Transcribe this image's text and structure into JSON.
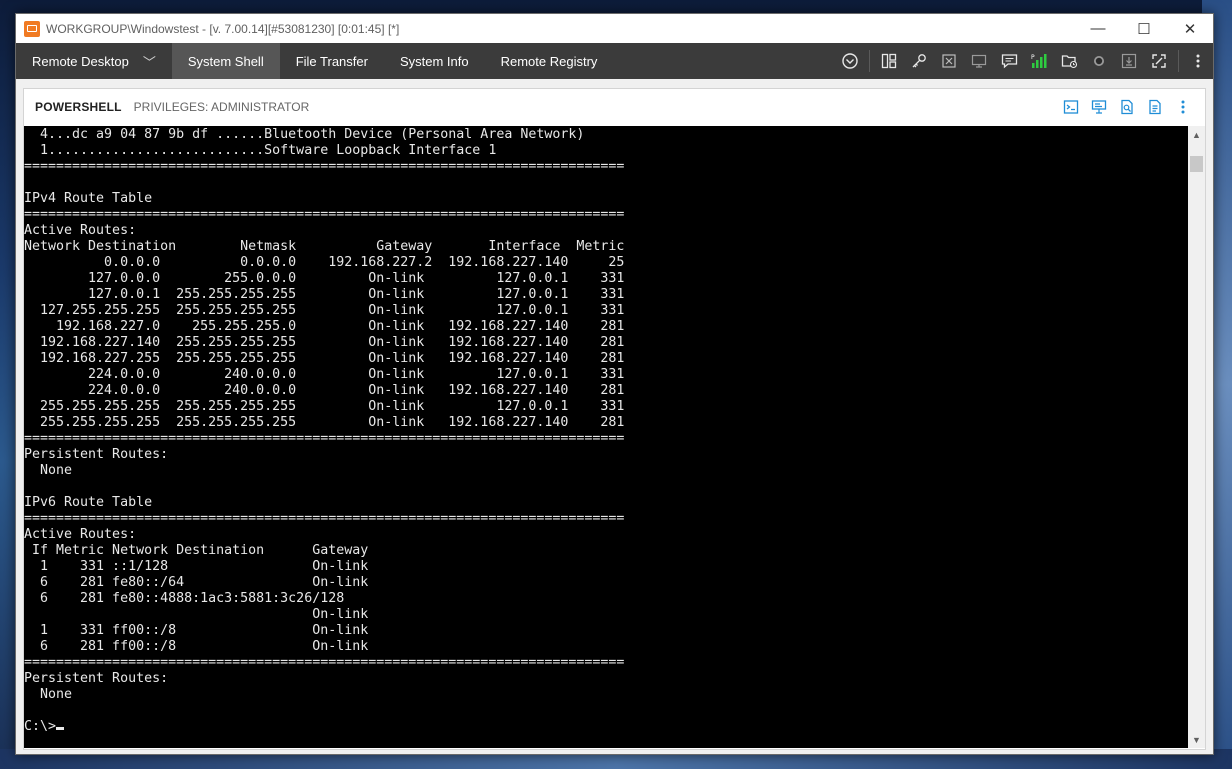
{
  "window": {
    "title": "WORKGROUP\\Windowstest - [v. 7.00.14][#53081230] [0:01:45] [*]",
    "controls": {
      "minimize": "—",
      "maximize": "☐",
      "close": "✕"
    }
  },
  "nav": {
    "tabs": [
      {
        "label": "Remote Desktop"
      },
      {
        "label": "System Shell"
      },
      {
        "label": "File Transfer"
      },
      {
        "label": "System Info"
      },
      {
        "label": "Remote Registry"
      }
    ],
    "chevron": "﹀"
  },
  "session": {
    "shell": "POWERSHELL",
    "privileges": "PRIVILEGES: ADMINISTRATOR"
  },
  "console": {
    "lines": [
      "  4...dc a9 04 87 9b df ......Bluetooth Device (Personal Area Network)",
      "  1...........................Software Loopback Interface 1",
      "===========================================================================",
      "",
      "IPv4 Route Table",
      "===========================================================================",
      "Active Routes:",
      "Network Destination        Netmask          Gateway       Interface  Metric",
      "          0.0.0.0          0.0.0.0    192.168.227.2  192.168.227.140     25",
      "        127.0.0.0        255.0.0.0         On-link         127.0.0.1    331",
      "        127.0.0.1  255.255.255.255         On-link         127.0.0.1    331",
      "  127.255.255.255  255.255.255.255         On-link         127.0.0.1    331",
      "    192.168.227.0    255.255.255.0         On-link   192.168.227.140    281",
      "  192.168.227.140  255.255.255.255         On-link   192.168.227.140    281",
      "  192.168.227.255  255.255.255.255         On-link   192.168.227.140    281",
      "        224.0.0.0        240.0.0.0         On-link         127.0.0.1    331",
      "        224.0.0.0        240.0.0.0         On-link   192.168.227.140    281",
      "  255.255.255.255  255.255.255.255         On-link         127.0.0.1    331",
      "  255.255.255.255  255.255.255.255         On-link   192.168.227.140    281",
      "===========================================================================",
      "Persistent Routes:",
      "  None",
      "",
      "IPv6 Route Table",
      "===========================================================================",
      "Active Routes:",
      " If Metric Network Destination      Gateway",
      "  1    331 ::1/128                  On-link",
      "  6    281 fe80::/64                On-link",
      "  6    281 fe80::4888:1ac3:5881:3c26/128",
      "                                    On-link",
      "  1    331 ff00::/8                 On-link",
      "  6    281 ff00::/8                 On-link",
      "===========================================================================",
      "Persistent Routes:",
      "  None",
      ""
    ],
    "prompt": "C:\\>"
  }
}
